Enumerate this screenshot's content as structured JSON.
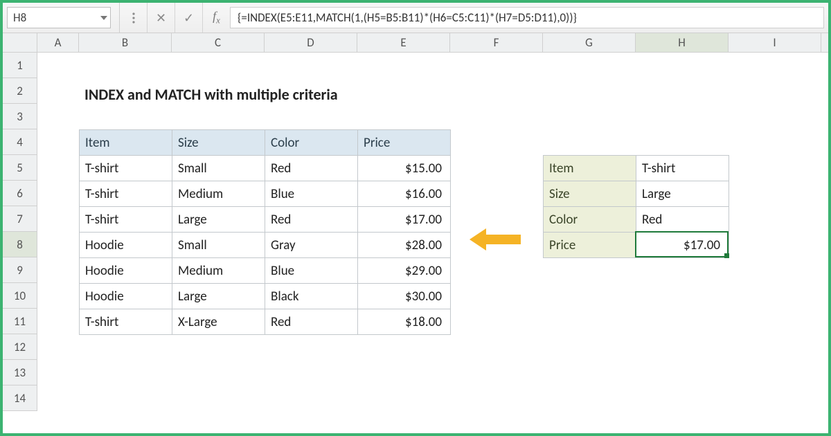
{
  "namebox": {
    "value": "H8"
  },
  "formula_bar": {
    "value": "{=INDEX(E5:E11,MATCH(1,(H5=B5:B11)*(H6=C5:C11)*(H7=D5:D11),0))}"
  },
  "columns": [
    "A",
    "B",
    "C",
    "D",
    "E",
    "F",
    "G",
    "H",
    "I"
  ],
  "rows": [
    "1",
    "2",
    "3",
    "4",
    "5",
    "6",
    "7",
    "8",
    "9",
    "10",
    "11",
    "12",
    "13",
    "14"
  ],
  "active_col": "H",
  "active_row": "8",
  "title": "INDEX and MATCH with multiple criteria",
  "table": {
    "headers": [
      "Item",
      "Size",
      "Color",
      "Price"
    ],
    "rows": [
      [
        "T-shirt",
        "Small",
        "Red",
        "$15.00"
      ],
      [
        "T-shirt",
        "Medium",
        "Blue",
        "$16.00"
      ],
      [
        "T-shirt",
        "Large",
        "Red",
        "$17.00"
      ],
      [
        "Hoodie",
        "Small",
        "Gray",
        "$28.00"
      ],
      [
        "Hoodie",
        "Medium",
        "Blue",
        "$29.00"
      ],
      [
        "Hoodie",
        "Large",
        "Black",
        "$30.00"
      ],
      [
        "T-shirt",
        "X-Large",
        "Red",
        "$18.00"
      ]
    ]
  },
  "lookup": {
    "rows": [
      {
        "label": "Item",
        "value": "T-shirt"
      },
      {
        "label": "Size",
        "value": "Large"
      },
      {
        "label": "Color",
        "value": "Red"
      },
      {
        "label": "Price",
        "value": "$17.00"
      }
    ]
  },
  "icons": {
    "cancel_glyph": "✕",
    "accept_glyph": "✓"
  },
  "colors": {
    "accent": "#3cb371",
    "active_border": "#1f7a3a",
    "header_bg": "#dbe7f0",
    "lookup_bg": "#edf0da",
    "arrow": "#f5b325"
  }
}
